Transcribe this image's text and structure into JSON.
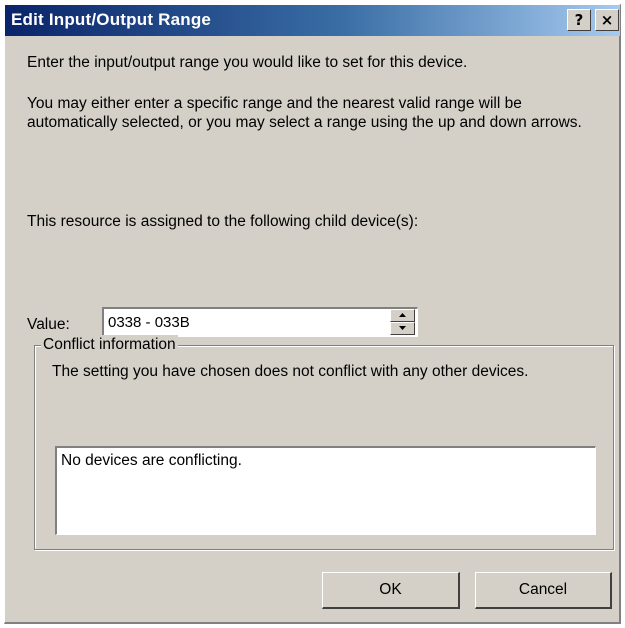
{
  "dialog": {
    "title": "Edit Input/Output Range",
    "help_button": "?",
    "close_button": "×",
    "intro": "Enter the input/output range you would like to set for this device.",
    "instructions": "You may either enter a specific range and the nearest valid range will be automatically selected, or you may select a range using the up and down arrows.",
    "assignment": "This resource is assigned to the following child device(s):",
    "value_label": "Value:",
    "value": "0338 - 033B",
    "conflict_group_label": "Conflict information",
    "conflict_message": "The setting you have chosen does not conflict with any other devices.",
    "conflict_list": [
      "No devices are conflicting."
    ],
    "ok_label": "OK",
    "cancel_label": "Cancel"
  },
  "colors": {
    "face": "#d4d0c8",
    "title_start": "#0a246a",
    "title_end": "#a6caf0"
  }
}
